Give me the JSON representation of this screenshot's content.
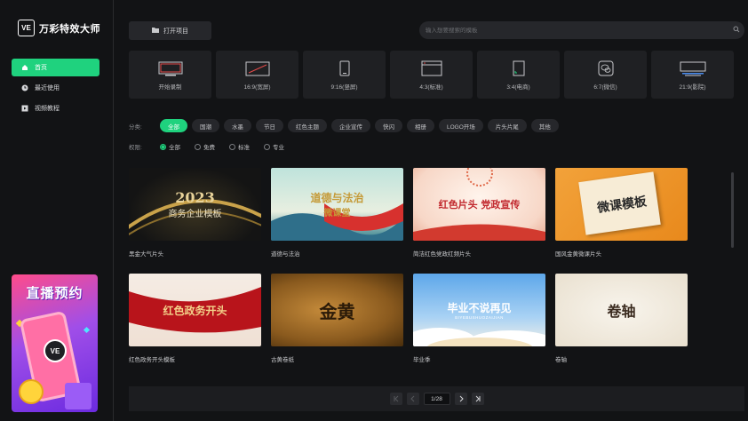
{
  "app": {
    "logo_mark": "VE",
    "name": "万彩特效大师"
  },
  "sidebar": {
    "items": [
      {
        "label": "首页",
        "icon": "home-icon",
        "active": true
      },
      {
        "label": "最近使用",
        "icon": "clock-icon",
        "active": false
      },
      {
        "label": "视频教程",
        "icon": "video-icon",
        "active": false
      }
    ],
    "promo": {
      "title": "直播预约",
      "badge": "VE"
    }
  },
  "toolbar": {
    "open_project": "打开项目",
    "search_placeholder": "输入想要搜索的模板"
  },
  "sizes": [
    {
      "label": "开始录制",
      "icon": "record-icon"
    },
    {
      "label": "16:9(宽屏)",
      "icon": "widescreen-icon"
    },
    {
      "label": "9:16(竖屏)",
      "icon": "portrait-icon"
    },
    {
      "label": "4:3(标准)",
      "icon": "standard-icon"
    },
    {
      "label": "3:4(电商)",
      "icon": "ecommerce-icon"
    },
    {
      "label": "6:7(微信)",
      "icon": "wechat-icon"
    },
    {
      "label": "21:9(影院)",
      "icon": "cinema-icon"
    }
  ],
  "filters": {
    "category_label": "分类:",
    "categories": [
      "全部",
      "国潮",
      "水墨",
      "节日",
      "红色主题",
      "企业宣传",
      "快闪",
      "相册",
      "LOGO开场",
      "片头片尾",
      "其他"
    ],
    "active_category": "全部",
    "permission_label": "权限:",
    "permissions": [
      "全部",
      "免费",
      "标准",
      "专业"
    ],
    "active_permission": "全部"
  },
  "templates": [
    {
      "title": "黑金大气片头",
      "thumb_text": "2023",
      "thumb_sub": "商务企业模板"
    },
    {
      "title": "道德与法治",
      "thumb_text": "道德与法治",
      "thumb_sub": "微课堂"
    },
    {
      "title": "简洁红色党政红频片头",
      "thumb_text": "红色片头 党政宣传",
      "thumb_sub": ""
    },
    {
      "title": "国风金黄微课片头",
      "thumb_text": "微课模板",
      "thumb_sub": ""
    },
    {
      "title": "红色政务开头模板",
      "thumb_text": "红色政务开头",
      "thumb_sub": ""
    },
    {
      "title": "古黄卷纸",
      "thumb_text": "金黄",
      "thumb_sub": ""
    },
    {
      "title": "毕业季",
      "thumb_text": "毕业不说再见",
      "thumb_sub": "BIYEBUSHUOZAIJIAN"
    },
    {
      "title": "卷轴",
      "thumb_text": "卷轴",
      "thumb_sub": ""
    }
  ],
  "pagination": {
    "current": "1/28"
  },
  "colors": {
    "accent": "#1fd27e",
    "background": "#121315",
    "card": "#1f2023"
  }
}
